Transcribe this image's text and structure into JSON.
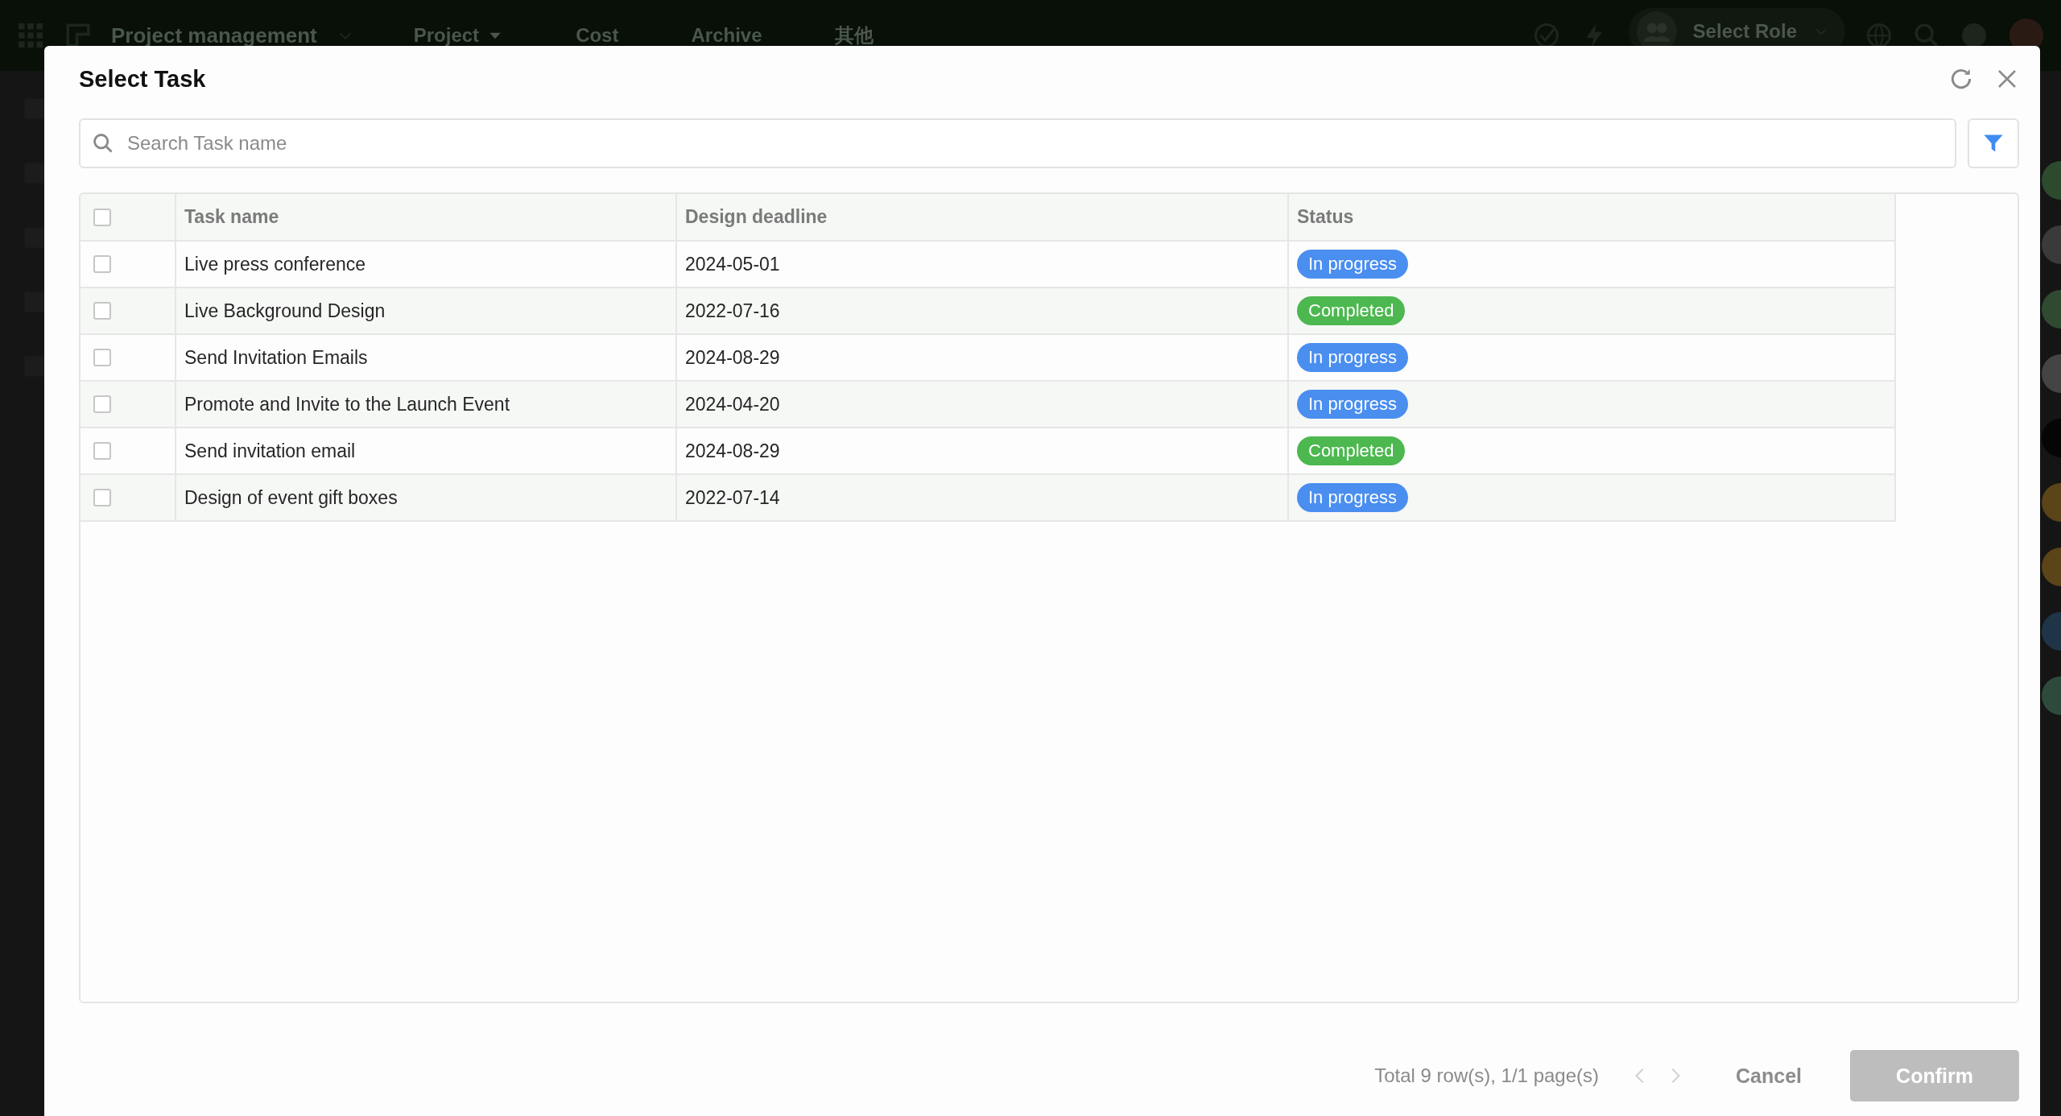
{
  "app_bar": {
    "title": "Project management",
    "nav": [
      {
        "label": "Project",
        "kind": "menu"
      },
      {
        "label": "Cost",
        "kind": "link"
      },
      {
        "label": "Archive",
        "kind": "link"
      },
      {
        "label": "其他",
        "kind": "link"
      }
    ],
    "role_select": {
      "label": "Select Role"
    }
  },
  "dialog": {
    "title": "Select Task",
    "search": {
      "placeholder": "Search Task name"
    },
    "table": {
      "select_all": {
        "checked": false
      },
      "columns": [
        "Task name",
        "Design deadline",
        "Status"
      ],
      "rows": [
        {
          "checked": false,
          "task": "Live press conference",
          "deadline": "2024-05-01",
          "status": {
            "label": "In progress",
            "color": "#4a8ef0"
          }
        },
        {
          "checked": false,
          "task": "Live Background Design",
          "deadline": "2022-07-16",
          "status": {
            "label": "Completed",
            "color": "#4cb84f"
          }
        },
        {
          "checked": false,
          "task": "Send Invitation Emails",
          "deadline": "2024-08-29",
          "status": {
            "label": "In progress",
            "color": "#4a8ef0"
          }
        },
        {
          "checked": false,
          "task": "Promote and Invite to the Launch Event",
          "deadline": "2024-04-20",
          "status": {
            "label": "In progress",
            "color": "#4a8ef0"
          }
        },
        {
          "checked": false,
          "task": "Send invitation email",
          "deadline": "2024-08-29",
          "status": {
            "label": "Completed",
            "color": "#4cb84f"
          }
        },
        {
          "checked": false,
          "task": "Design of event gift boxes",
          "deadline": "2022-07-14",
          "status": {
            "label": "In progress",
            "color": "#4a8ef0"
          }
        }
      ]
    },
    "footer": {
      "summary": "Total 9 row(s), 1/1 page(s)",
      "cancel": "Cancel",
      "confirm": {
        "label": "Confirm",
        "disabled": true
      }
    }
  }
}
